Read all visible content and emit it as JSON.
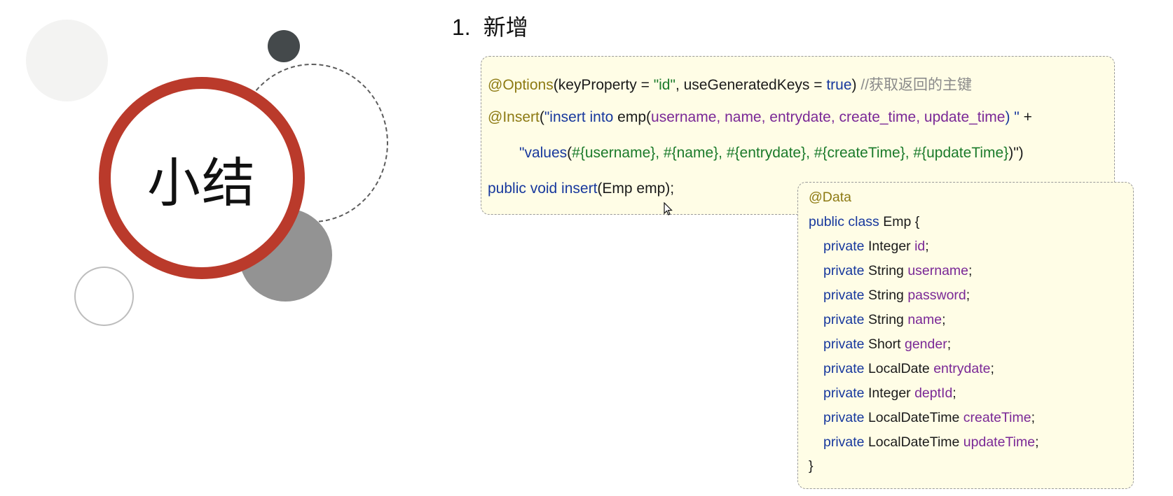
{
  "title_badge": "小结",
  "heading": {
    "number": "1.",
    "text": "新增"
  },
  "mapper_code": {
    "line1": {
      "annotation": "@Options",
      "args": "(keyProperty = ",
      "str1": "\"id\"",
      "mid": ", useGeneratedKeys = ",
      "bool": "true",
      "close": ")",
      "comment": "//获取返回的主键"
    },
    "line2": {
      "annotation": "@Insert",
      "open": "(",
      "str_kw": "\"insert into",
      "table": " emp(",
      "cols": "username, name, entrydate, create_time, update_time",
      "close": ") \"",
      "plus": " +"
    },
    "line3": {
      "str_values": "\"values",
      "open": "(",
      "params": "#{username}, #{name}, #{entrydate}, #{createTime}, #{updateTime}",
      "close": ")\")"
    },
    "line4": {
      "kw": "public void insert",
      "rest": "(Emp emp);"
    }
  },
  "entity_code": {
    "annotation": "@Data",
    "class_kw": "public class",
    "class_rest": " Emp {",
    "fields": [
      {
        "kw": "private",
        "type": " Integer ",
        "name": "id",
        "end": ";"
      },
      {
        "kw": "private",
        "type": " String ",
        "name": "username",
        "end": ";"
      },
      {
        "kw": "private",
        "type": " String ",
        "name": "password",
        "end": ";"
      },
      {
        "kw": "private",
        "type": " String ",
        "name": "name",
        "end": ";"
      },
      {
        "kw": "private",
        "type": " Short ",
        "name": "gender",
        "end": ";"
      },
      {
        "kw": "private",
        "type": " LocalDate ",
        "name": "entrydate",
        "end": ";"
      },
      {
        "kw": "private",
        "type": " Integer ",
        "name": "deptId",
        "end": ";"
      },
      {
        "kw": "private",
        "type": " LocalDateTime ",
        "name": "createTime",
        "end": ";"
      },
      {
        "kw": "private",
        "type": " LocalDateTime ",
        "name": "updateTime",
        "end": ";"
      }
    ],
    "close": "}"
  }
}
